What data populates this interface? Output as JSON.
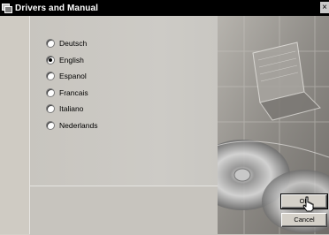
{
  "window": {
    "title": "Drivers and Manual",
    "close_glyph": "×"
  },
  "languages": [
    {
      "label": "Deutsch",
      "selected": false
    },
    {
      "label": "English",
      "selected": true
    },
    {
      "label": "Espanol",
      "selected": false
    },
    {
      "label": "Francais",
      "selected": false
    },
    {
      "label": "Italiano",
      "selected": false
    },
    {
      "label": "Nederlands",
      "selected": false
    }
  ],
  "buttons": {
    "ok": "OK",
    "cancel": "Cancel"
  },
  "icons": {
    "app": "installer-icon",
    "close": "close-icon",
    "cursor": "hand-pointer-icon"
  }
}
